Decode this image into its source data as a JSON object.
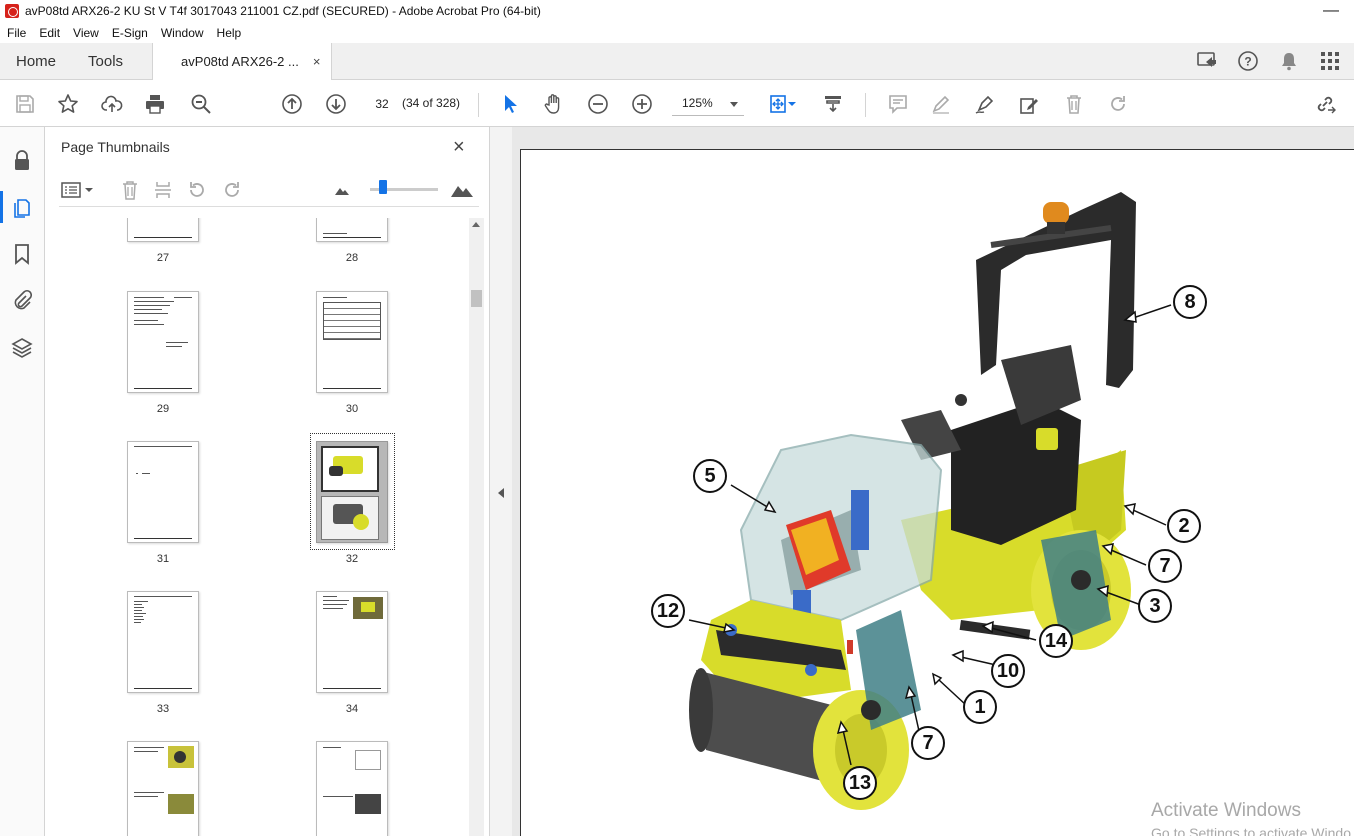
{
  "window": {
    "title": "avP08td ARX26-2 KU St V T4f 3017043 211001 CZ.pdf (SECURED) - Adobe Acrobat Pro (64-bit)",
    "minimize_glyph": "—"
  },
  "menu": [
    "File",
    "Edit",
    "View",
    "E-Sign",
    "Window",
    "Help"
  ],
  "tabs": {
    "home": "Home",
    "tools": "Tools",
    "document": "avP08td ARX26-2 ...",
    "close_glyph": "×"
  },
  "toolbar": {
    "page_number": "32",
    "page_count": "(34 of 328)",
    "zoom": "125%"
  },
  "panel": {
    "title": "Page Thumbnails",
    "close_glyph": "×",
    "thumbnails": [
      "27",
      "28",
      "29",
      "30",
      "31",
      "32",
      "33",
      "34"
    ],
    "selected_page": "32"
  },
  "document": {
    "callouts": [
      "1",
      "2",
      "3",
      "5",
      "7",
      "7",
      "8",
      "10",
      "12",
      "13",
      "14"
    ]
  },
  "watermark": {
    "line1": "Activate Windows",
    "line2": "Go to Settings to activate Windo"
  },
  "colors": {
    "accent": "#1473e6",
    "machine_yellow": "#d8dc2a",
    "machine_dark": "#2b2b2b",
    "acrobat_red": "#d6221b"
  }
}
